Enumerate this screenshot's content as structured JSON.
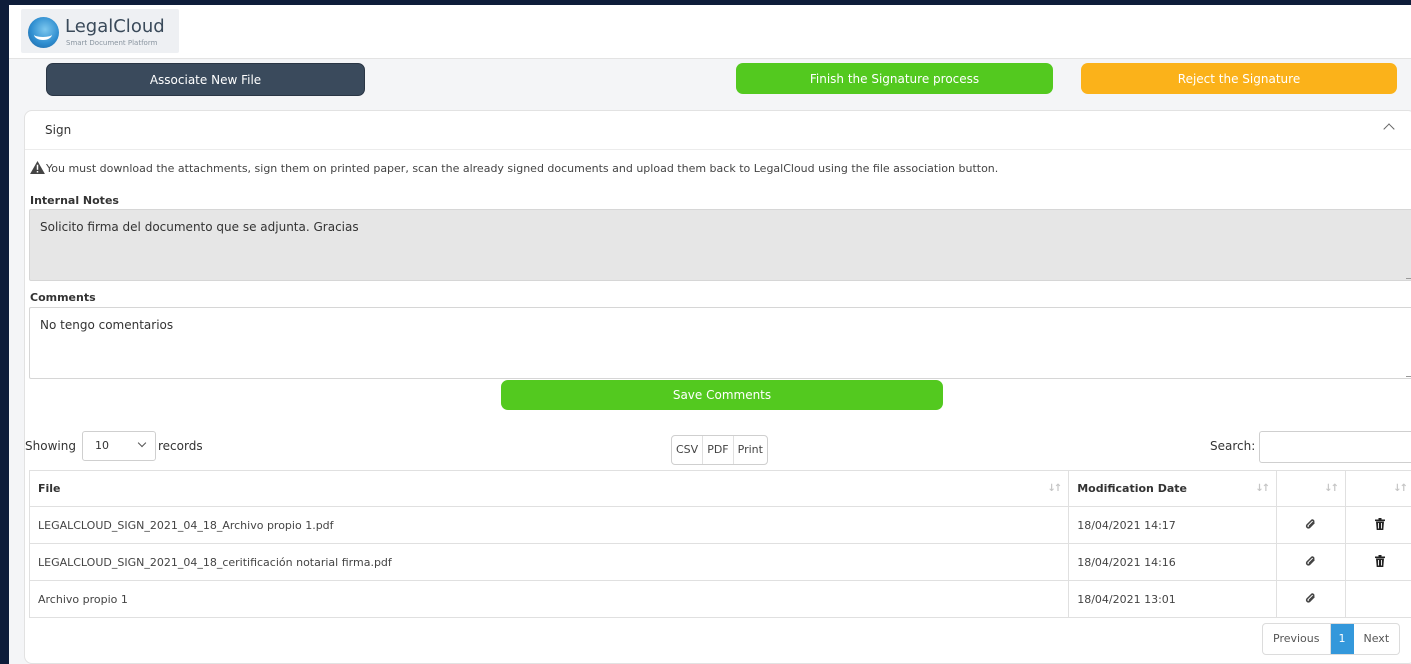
{
  "brand": {
    "name": "LegalCloud",
    "tagline": "Smart Document Platform"
  },
  "actions": {
    "associate_label": "Associate New File",
    "finish_label": "Finish the Signature process",
    "reject_label": "Reject the Signature",
    "colors": {
      "associate": "#3a4a5c",
      "finish": "#53c91f",
      "reject": "#fbb21a"
    }
  },
  "panel": {
    "title": "Sign",
    "warning": "You must download the attachments, sign them on printed paper, scan the already signed documents and upload them back to LegalCloud using the file association button.",
    "internal_notes_label": "Internal Notes",
    "internal_notes_value": "Solicito firma del documento que se adjunta. Gracias",
    "comments_label": "Comments",
    "comments_value": "No tengo comentarios",
    "save_label": "Save Comments"
  },
  "table_controls": {
    "showing_label": "Showing",
    "page_size": "10",
    "records_label": "records",
    "export_buttons": [
      "CSV",
      "PDF",
      "Print"
    ],
    "search_label": "Search:"
  },
  "table": {
    "headers": [
      "File",
      "Modification Date",
      "",
      ""
    ],
    "rows": [
      {
        "file": "LEGALCLOUD_SIGN_2021_04_18_Archivo propio 1.pdf",
        "date": "18/04/2021 14:17",
        "attach": "paperclip-icon",
        "delete": "trash-icon"
      },
      {
        "file": "LEGALCLOUD_SIGN_2021_04_18_ceritificación notarial firma.pdf",
        "date": "18/04/2021 14:16",
        "attach": "paperclip-icon",
        "delete": "trash-icon"
      },
      {
        "file": "Archivo propio 1",
        "date": "18/04/2021 13:01",
        "attach": "paperclip-icon",
        "delete": null
      }
    ]
  },
  "pagination": {
    "previous": "Previous",
    "current": "1",
    "next": "Next",
    "accent": "#3498db"
  }
}
